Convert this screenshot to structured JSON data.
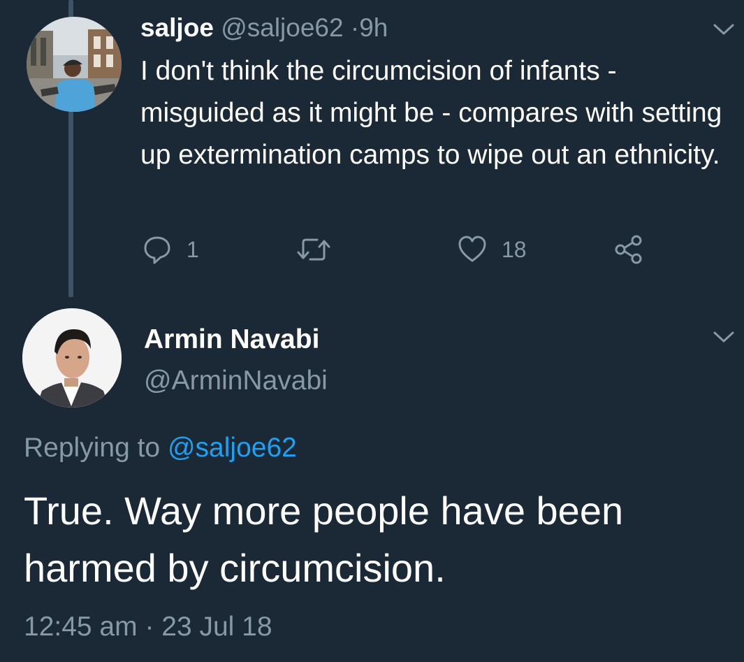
{
  "colors": {
    "background": "#1b2836",
    "primary_text": "#ffffff",
    "secondary_text": "#8899a6",
    "link": "#1da1f2",
    "thread_line": "#3d5466"
  },
  "reply_tweet": {
    "name": "saljoe",
    "handle": "@saljoe62",
    "separator": "·",
    "time": "9h",
    "text": "I don't think the circumcision of infants - misguided as it might be - compares with setting up extermination camps to wipe out an ethnicity.",
    "actions": {
      "reply_icon": "reply-icon",
      "reply_count": "1",
      "retweet_icon": "retweet-icon",
      "like_icon": "heart-icon",
      "like_count": "18",
      "share_icon": "share-icon"
    }
  },
  "main_tweet": {
    "name": "Armin Navabi",
    "handle": "@ArminNavabi",
    "replying_prefix": "Replying to",
    "replying_to": "@saljoe62",
    "text": "True. Way more people have been harmed by circumcision.",
    "timestamp": "12:45 am · 23 Jul 18"
  }
}
